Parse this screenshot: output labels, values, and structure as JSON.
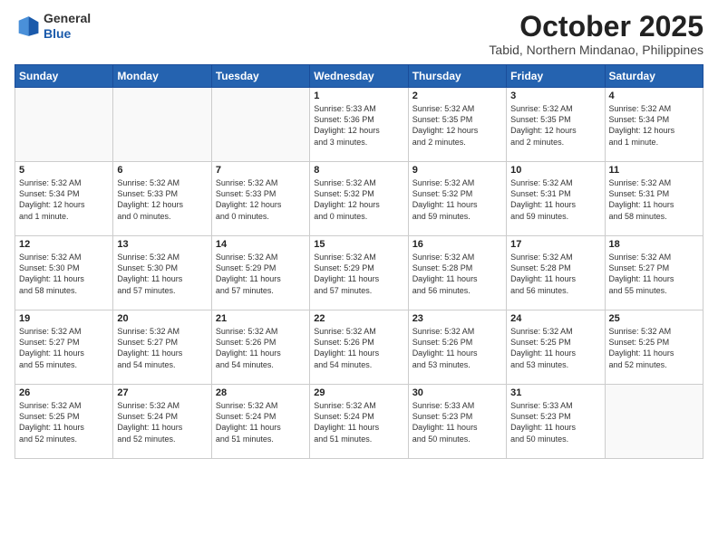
{
  "header": {
    "logo_general": "General",
    "logo_blue": "Blue",
    "month_title": "October 2025",
    "location": "Tabid, Northern Mindanao, Philippines"
  },
  "weekdays": [
    "Sunday",
    "Monday",
    "Tuesday",
    "Wednesday",
    "Thursday",
    "Friday",
    "Saturday"
  ],
  "weeks": [
    [
      {
        "day": "",
        "detail": ""
      },
      {
        "day": "",
        "detail": ""
      },
      {
        "day": "",
        "detail": ""
      },
      {
        "day": "1",
        "detail": "Sunrise: 5:33 AM\nSunset: 5:36 PM\nDaylight: 12 hours\nand 3 minutes."
      },
      {
        "day": "2",
        "detail": "Sunrise: 5:32 AM\nSunset: 5:35 PM\nDaylight: 12 hours\nand 2 minutes."
      },
      {
        "day": "3",
        "detail": "Sunrise: 5:32 AM\nSunset: 5:35 PM\nDaylight: 12 hours\nand 2 minutes."
      },
      {
        "day": "4",
        "detail": "Sunrise: 5:32 AM\nSunset: 5:34 PM\nDaylight: 12 hours\nand 1 minute."
      }
    ],
    [
      {
        "day": "5",
        "detail": "Sunrise: 5:32 AM\nSunset: 5:34 PM\nDaylight: 12 hours\nand 1 minute."
      },
      {
        "day": "6",
        "detail": "Sunrise: 5:32 AM\nSunset: 5:33 PM\nDaylight: 12 hours\nand 0 minutes."
      },
      {
        "day": "7",
        "detail": "Sunrise: 5:32 AM\nSunset: 5:33 PM\nDaylight: 12 hours\nand 0 minutes."
      },
      {
        "day": "8",
        "detail": "Sunrise: 5:32 AM\nSunset: 5:32 PM\nDaylight: 12 hours\nand 0 minutes."
      },
      {
        "day": "9",
        "detail": "Sunrise: 5:32 AM\nSunset: 5:32 PM\nDaylight: 11 hours\nand 59 minutes."
      },
      {
        "day": "10",
        "detail": "Sunrise: 5:32 AM\nSunset: 5:31 PM\nDaylight: 11 hours\nand 59 minutes."
      },
      {
        "day": "11",
        "detail": "Sunrise: 5:32 AM\nSunset: 5:31 PM\nDaylight: 11 hours\nand 58 minutes."
      }
    ],
    [
      {
        "day": "12",
        "detail": "Sunrise: 5:32 AM\nSunset: 5:30 PM\nDaylight: 11 hours\nand 58 minutes."
      },
      {
        "day": "13",
        "detail": "Sunrise: 5:32 AM\nSunset: 5:30 PM\nDaylight: 11 hours\nand 57 minutes."
      },
      {
        "day": "14",
        "detail": "Sunrise: 5:32 AM\nSunset: 5:29 PM\nDaylight: 11 hours\nand 57 minutes."
      },
      {
        "day": "15",
        "detail": "Sunrise: 5:32 AM\nSunset: 5:29 PM\nDaylight: 11 hours\nand 57 minutes."
      },
      {
        "day": "16",
        "detail": "Sunrise: 5:32 AM\nSunset: 5:28 PM\nDaylight: 11 hours\nand 56 minutes."
      },
      {
        "day": "17",
        "detail": "Sunrise: 5:32 AM\nSunset: 5:28 PM\nDaylight: 11 hours\nand 56 minutes."
      },
      {
        "day": "18",
        "detail": "Sunrise: 5:32 AM\nSunset: 5:27 PM\nDaylight: 11 hours\nand 55 minutes."
      }
    ],
    [
      {
        "day": "19",
        "detail": "Sunrise: 5:32 AM\nSunset: 5:27 PM\nDaylight: 11 hours\nand 55 minutes."
      },
      {
        "day": "20",
        "detail": "Sunrise: 5:32 AM\nSunset: 5:27 PM\nDaylight: 11 hours\nand 54 minutes."
      },
      {
        "day": "21",
        "detail": "Sunrise: 5:32 AM\nSunset: 5:26 PM\nDaylight: 11 hours\nand 54 minutes."
      },
      {
        "day": "22",
        "detail": "Sunrise: 5:32 AM\nSunset: 5:26 PM\nDaylight: 11 hours\nand 54 minutes."
      },
      {
        "day": "23",
        "detail": "Sunrise: 5:32 AM\nSunset: 5:26 PM\nDaylight: 11 hours\nand 53 minutes."
      },
      {
        "day": "24",
        "detail": "Sunrise: 5:32 AM\nSunset: 5:25 PM\nDaylight: 11 hours\nand 53 minutes."
      },
      {
        "day": "25",
        "detail": "Sunrise: 5:32 AM\nSunset: 5:25 PM\nDaylight: 11 hours\nand 52 minutes."
      }
    ],
    [
      {
        "day": "26",
        "detail": "Sunrise: 5:32 AM\nSunset: 5:25 PM\nDaylight: 11 hours\nand 52 minutes."
      },
      {
        "day": "27",
        "detail": "Sunrise: 5:32 AM\nSunset: 5:24 PM\nDaylight: 11 hours\nand 52 minutes."
      },
      {
        "day": "28",
        "detail": "Sunrise: 5:32 AM\nSunset: 5:24 PM\nDaylight: 11 hours\nand 51 minutes."
      },
      {
        "day": "29",
        "detail": "Sunrise: 5:32 AM\nSunset: 5:24 PM\nDaylight: 11 hours\nand 51 minutes."
      },
      {
        "day": "30",
        "detail": "Sunrise: 5:33 AM\nSunset: 5:23 PM\nDaylight: 11 hours\nand 50 minutes."
      },
      {
        "day": "31",
        "detail": "Sunrise: 5:33 AM\nSunset: 5:23 PM\nDaylight: 11 hours\nand 50 minutes."
      },
      {
        "day": "",
        "detail": ""
      }
    ]
  ]
}
